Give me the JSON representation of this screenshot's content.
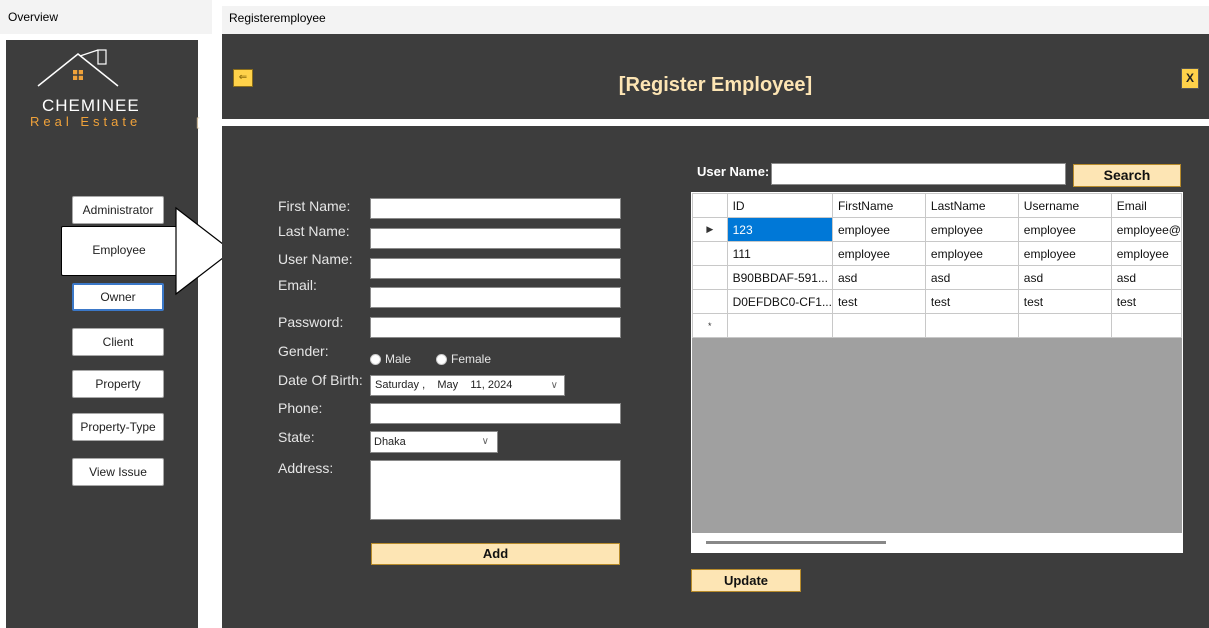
{
  "overview_window": {
    "title": "Overview",
    "logo": {
      "brand": "CHEMINEE",
      "sub": "Real Estate",
      "bracket": "["
    },
    "nav": [
      {
        "label": "Administrator",
        "key": "administrator"
      },
      {
        "label": "Employee",
        "key": "employee"
      },
      {
        "label": "Owner",
        "key": "owner"
      },
      {
        "label": "Client",
        "key": "client"
      },
      {
        "label": "Property",
        "key": "property"
      },
      {
        "label": "Property-Type",
        "key": "property-type"
      },
      {
        "label": "View Issue",
        "key": "view-issue"
      }
    ]
  },
  "register_window": {
    "title": "Registeremployee",
    "header": {
      "page_title": "[Register Employee]",
      "back_icon": "back-arrow-icon",
      "close_label": "X"
    },
    "form": {
      "first_name_label": "First Name:",
      "last_name_label": "Last Name:",
      "user_name_label": "User Name:",
      "email_label": "Email:",
      "password_label": "Password:",
      "gender_label": "Gender:",
      "gender_options": [
        "Male",
        "Female"
      ],
      "dob_label": "Date Of Birth:",
      "dob_value": "Saturday ,    May    11, 2024",
      "phone_label": "Phone:",
      "state_label": "State:",
      "state_value": "Dhaka",
      "address_label": "Address:",
      "add_label": "Add"
    },
    "search": {
      "label": "User Name:",
      "value": "",
      "button": "Search"
    },
    "grid": {
      "columns": [
        "ID",
        "FirstName",
        "LastName",
        "Username",
        "Email"
      ],
      "rows": [
        {
          "marker": "▶",
          "cells": [
            "123",
            "employee",
            "employee",
            "employee",
            "employee@"
          ]
        },
        {
          "marker": "",
          "cells": [
            "111",
            "employee",
            "employee",
            "employee",
            "employee"
          ]
        },
        {
          "marker": "",
          "cells": [
            "B90BBDAF-591...",
            "asd",
            "asd",
            "asd",
            "asd"
          ]
        },
        {
          "marker": "",
          "cells": [
            "D0EFDBC0-CF1...",
            "test",
            "test",
            "test",
            "test"
          ]
        },
        {
          "marker": "*",
          "cells": [
            "",
            "",
            "",
            "",
            ""
          ]
        }
      ]
    },
    "update_label": "Update"
  },
  "colors": {
    "panel": "#3d3d3d",
    "accent_gold": "#fde5b4",
    "logo_orange": "#f0a23a",
    "selection": "#0078d7"
  }
}
